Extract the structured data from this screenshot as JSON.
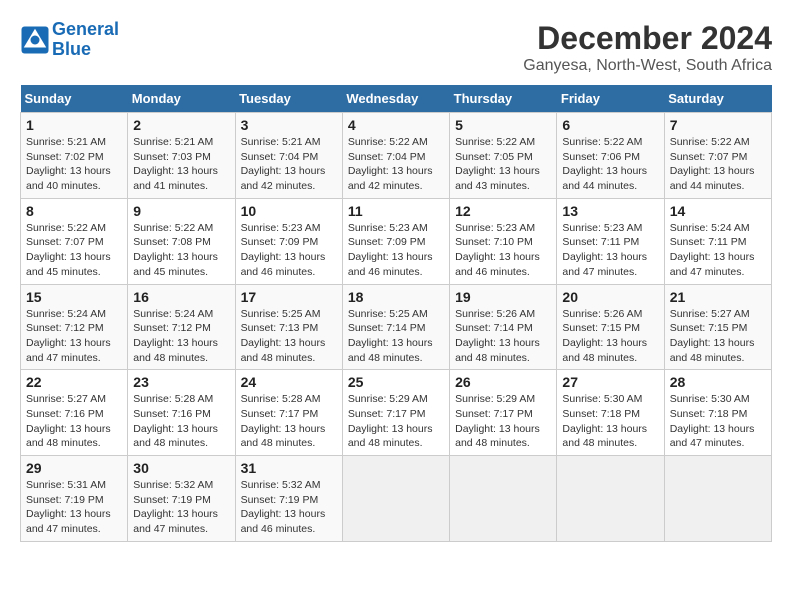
{
  "logo": {
    "line1": "General",
    "line2": "Blue"
  },
  "title": "December 2024",
  "subtitle": "Ganyesa, North-West, South Africa",
  "days_of_week": [
    "Sunday",
    "Monday",
    "Tuesday",
    "Wednesday",
    "Thursday",
    "Friday",
    "Saturday"
  ],
  "weeks": [
    [
      {
        "day": "1",
        "sunrise": "5:21 AM",
        "sunset": "7:02 PM",
        "daylight": "13 hours and 40 minutes."
      },
      {
        "day": "2",
        "sunrise": "5:21 AM",
        "sunset": "7:03 PM",
        "daylight": "13 hours and 41 minutes."
      },
      {
        "day": "3",
        "sunrise": "5:21 AM",
        "sunset": "7:04 PM",
        "daylight": "13 hours and 42 minutes."
      },
      {
        "day": "4",
        "sunrise": "5:22 AM",
        "sunset": "7:04 PM",
        "daylight": "13 hours and 42 minutes."
      },
      {
        "day": "5",
        "sunrise": "5:22 AM",
        "sunset": "7:05 PM",
        "daylight": "13 hours and 43 minutes."
      },
      {
        "day": "6",
        "sunrise": "5:22 AM",
        "sunset": "7:06 PM",
        "daylight": "13 hours and 44 minutes."
      },
      {
        "day": "7",
        "sunrise": "5:22 AM",
        "sunset": "7:07 PM",
        "daylight": "13 hours and 44 minutes."
      }
    ],
    [
      {
        "day": "8",
        "sunrise": "5:22 AM",
        "sunset": "7:07 PM",
        "daylight": "13 hours and 45 minutes."
      },
      {
        "day": "9",
        "sunrise": "5:22 AM",
        "sunset": "7:08 PM",
        "daylight": "13 hours and 45 minutes."
      },
      {
        "day": "10",
        "sunrise": "5:23 AM",
        "sunset": "7:09 PM",
        "daylight": "13 hours and 46 minutes."
      },
      {
        "day": "11",
        "sunrise": "5:23 AM",
        "sunset": "7:09 PM",
        "daylight": "13 hours and 46 minutes."
      },
      {
        "day": "12",
        "sunrise": "5:23 AM",
        "sunset": "7:10 PM",
        "daylight": "13 hours and 46 minutes."
      },
      {
        "day": "13",
        "sunrise": "5:23 AM",
        "sunset": "7:11 PM",
        "daylight": "13 hours and 47 minutes."
      },
      {
        "day": "14",
        "sunrise": "5:24 AM",
        "sunset": "7:11 PM",
        "daylight": "13 hours and 47 minutes."
      }
    ],
    [
      {
        "day": "15",
        "sunrise": "5:24 AM",
        "sunset": "7:12 PM",
        "daylight": "13 hours and 47 minutes."
      },
      {
        "day": "16",
        "sunrise": "5:24 AM",
        "sunset": "7:12 PM",
        "daylight": "13 hours and 48 minutes."
      },
      {
        "day": "17",
        "sunrise": "5:25 AM",
        "sunset": "7:13 PM",
        "daylight": "13 hours and 48 minutes."
      },
      {
        "day": "18",
        "sunrise": "5:25 AM",
        "sunset": "7:14 PM",
        "daylight": "13 hours and 48 minutes."
      },
      {
        "day": "19",
        "sunrise": "5:26 AM",
        "sunset": "7:14 PM",
        "daylight": "13 hours and 48 minutes."
      },
      {
        "day": "20",
        "sunrise": "5:26 AM",
        "sunset": "7:15 PM",
        "daylight": "13 hours and 48 minutes."
      },
      {
        "day": "21",
        "sunrise": "5:27 AM",
        "sunset": "7:15 PM",
        "daylight": "13 hours and 48 minutes."
      }
    ],
    [
      {
        "day": "22",
        "sunrise": "5:27 AM",
        "sunset": "7:16 PM",
        "daylight": "13 hours and 48 minutes."
      },
      {
        "day": "23",
        "sunrise": "5:28 AM",
        "sunset": "7:16 PM",
        "daylight": "13 hours and 48 minutes."
      },
      {
        "day": "24",
        "sunrise": "5:28 AM",
        "sunset": "7:17 PM",
        "daylight": "13 hours and 48 minutes."
      },
      {
        "day": "25",
        "sunrise": "5:29 AM",
        "sunset": "7:17 PM",
        "daylight": "13 hours and 48 minutes."
      },
      {
        "day": "26",
        "sunrise": "5:29 AM",
        "sunset": "7:17 PM",
        "daylight": "13 hours and 48 minutes."
      },
      {
        "day": "27",
        "sunrise": "5:30 AM",
        "sunset": "7:18 PM",
        "daylight": "13 hours and 48 minutes."
      },
      {
        "day": "28",
        "sunrise": "5:30 AM",
        "sunset": "7:18 PM",
        "daylight": "13 hours and 47 minutes."
      }
    ],
    [
      {
        "day": "29",
        "sunrise": "5:31 AM",
        "sunset": "7:19 PM",
        "daylight": "13 hours and 47 minutes."
      },
      {
        "day": "30",
        "sunrise": "5:32 AM",
        "sunset": "7:19 PM",
        "daylight": "13 hours and 47 minutes."
      },
      {
        "day": "31",
        "sunrise": "5:32 AM",
        "sunset": "7:19 PM",
        "daylight": "13 hours and 46 minutes."
      },
      null,
      null,
      null,
      null
    ]
  ],
  "labels": {
    "sunrise": "Sunrise:",
    "sunset": "Sunset:",
    "daylight": "Daylight:"
  }
}
